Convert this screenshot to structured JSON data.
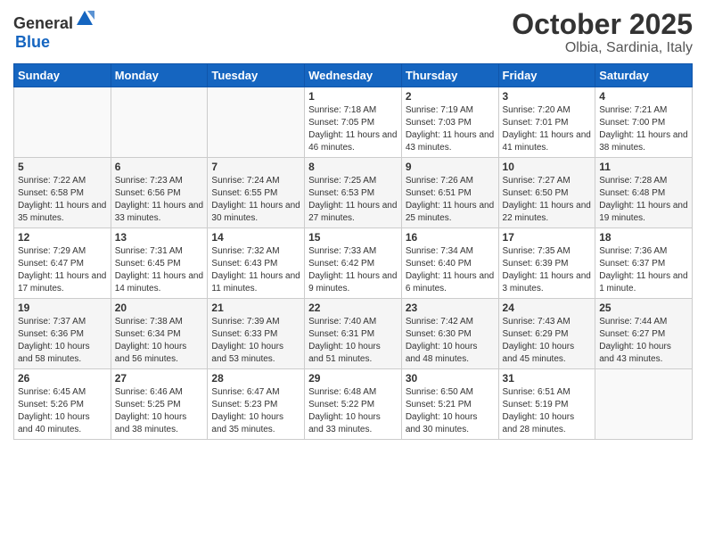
{
  "header": {
    "logo_general": "General",
    "logo_blue": "Blue",
    "month": "October 2025",
    "location": "Olbia, Sardinia, Italy"
  },
  "weekdays": [
    "Sunday",
    "Monday",
    "Tuesday",
    "Wednesday",
    "Thursday",
    "Friday",
    "Saturday"
  ],
  "weeks": [
    [
      {
        "day": "",
        "empty": true
      },
      {
        "day": "",
        "empty": true
      },
      {
        "day": "",
        "empty": true
      },
      {
        "day": "1",
        "sunrise": "7:18 AM",
        "sunset": "7:05 PM",
        "daylight": "11 hours and 46 minutes."
      },
      {
        "day": "2",
        "sunrise": "7:19 AM",
        "sunset": "7:03 PM",
        "daylight": "11 hours and 43 minutes."
      },
      {
        "day": "3",
        "sunrise": "7:20 AM",
        "sunset": "7:01 PM",
        "daylight": "11 hours and 41 minutes."
      },
      {
        "day": "4",
        "sunrise": "7:21 AM",
        "sunset": "7:00 PM",
        "daylight": "11 hours and 38 minutes."
      }
    ],
    [
      {
        "day": "5",
        "sunrise": "7:22 AM",
        "sunset": "6:58 PM",
        "daylight": "11 hours and 35 minutes."
      },
      {
        "day": "6",
        "sunrise": "7:23 AM",
        "sunset": "6:56 PM",
        "daylight": "11 hours and 33 minutes."
      },
      {
        "day": "7",
        "sunrise": "7:24 AM",
        "sunset": "6:55 PM",
        "daylight": "11 hours and 30 minutes."
      },
      {
        "day": "8",
        "sunrise": "7:25 AM",
        "sunset": "6:53 PM",
        "daylight": "11 hours and 27 minutes."
      },
      {
        "day": "9",
        "sunrise": "7:26 AM",
        "sunset": "6:51 PM",
        "daylight": "11 hours and 25 minutes."
      },
      {
        "day": "10",
        "sunrise": "7:27 AM",
        "sunset": "6:50 PM",
        "daylight": "11 hours and 22 minutes."
      },
      {
        "day": "11",
        "sunrise": "7:28 AM",
        "sunset": "6:48 PM",
        "daylight": "11 hours and 19 minutes."
      }
    ],
    [
      {
        "day": "12",
        "sunrise": "7:29 AM",
        "sunset": "6:47 PM",
        "daylight": "11 hours and 17 minutes."
      },
      {
        "day": "13",
        "sunrise": "7:31 AM",
        "sunset": "6:45 PM",
        "daylight": "11 hours and 14 minutes."
      },
      {
        "day": "14",
        "sunrise": "7:32 AM",
        "sunset": "6:43 PM",
        "daylight": "11 hours and 11 minutes."
      },
      {
        "day": "15",
        "sunrise": "7:33 AM",
        "sunset": "6:42 PM",
        "daylight": "11 hours and 9 minutes."
      },
      {
        "day": "16",
        "sunrise": "7:34 AM",
        "sunset": "6:40 PM",
        "daylight": "11 hours and 6 minutes."
      },
      {
        "day": "17",
        "sunrise": "7:35 AM",
        "sunset": "6:39 PM",
        "daylight": "11 hours and 3 minutes."
      },
      {
        "day": "18",
        "sunrise": "7:36 AM",
        "sunset": "6:37 PM",
        "daylight": "11 hours and 1 minute."
      }
    ],
    [
      {
        "day": "19",
        "sunrise": "7:37 AM",
        "sunset": "6:36 PM",
        "daylight": "10 hours and 58 minutes."
      },
      {
        "day": "20",
        "sunrise": "7:38 AM",
        "sunset": "6:34 PM",
        "daylight": "10 hours and 56 minutes."
      },
      {
        "day": "21",
        "sunrise": "7:39 AM",
        "sunset": "6:33 PM",
        "daylight": "10 hours and 53 minutes."
      },
      {
        "day": "22",
        "sunrise": "7:40 AM",
        "sunset": "6:31 PM",
        "daylight": "10 hours and 51 minutes."
      },
      {
        "day": "23",
        "sunrise": "7:42 AM",
        "sunset": "6:30 PM",
        "daylight": "10 hours and 48 minutes."
      },
      {
        "day": "24",
        "sunrise": "7:43 AM",
        "sunset": "6:29 PM",
        "daylight": "10 hours and 45 minutes."
      },
      {
        "day": "25",
        "sunrise": "7:44 AM",
        "sunset": "6:27 PM",
        "daylight": "10 hours and 43 minutes."
      }
    ],
    [
      {
        "day": "26",
        "sunrise": "6:45 AM",
        "sunset": "5:26 PM",
        "daylight": "10 hours and 40 minutes."
      },
      {
        "day": "27",
        "sunrise": "6:46 AM",
        "sunset": "5:25 PM",
        "daylight": "10 hours and 38 minutes."
      },
      {
        "day": "28",
        "sunrise": "6:47 AM",
        "sunset": "5:23 PM",
        "daylight": "10 hours and 35 minutes."
      },
      {
        "day": "29",
        "sunrise": "6:48 AM",
        "sunset": "5:22 PM",
        "daylight": "10 hours and 33 minutes."
      },
      {
        "day": "30",
        "sunrise": "6:50 AM",
        "sunset": "5:21 PM",
        "daylight": "10 hours and 30 minutes."
      },
      {
        "day": "31",
        "sunrise": "6:51 AM",
        "sunset": "5:19 PM",
        "daylight": "10 hours and 28 minutes."
      },
      {
        "day": "",
        "empty": true
      }
    ]
  ]
}
